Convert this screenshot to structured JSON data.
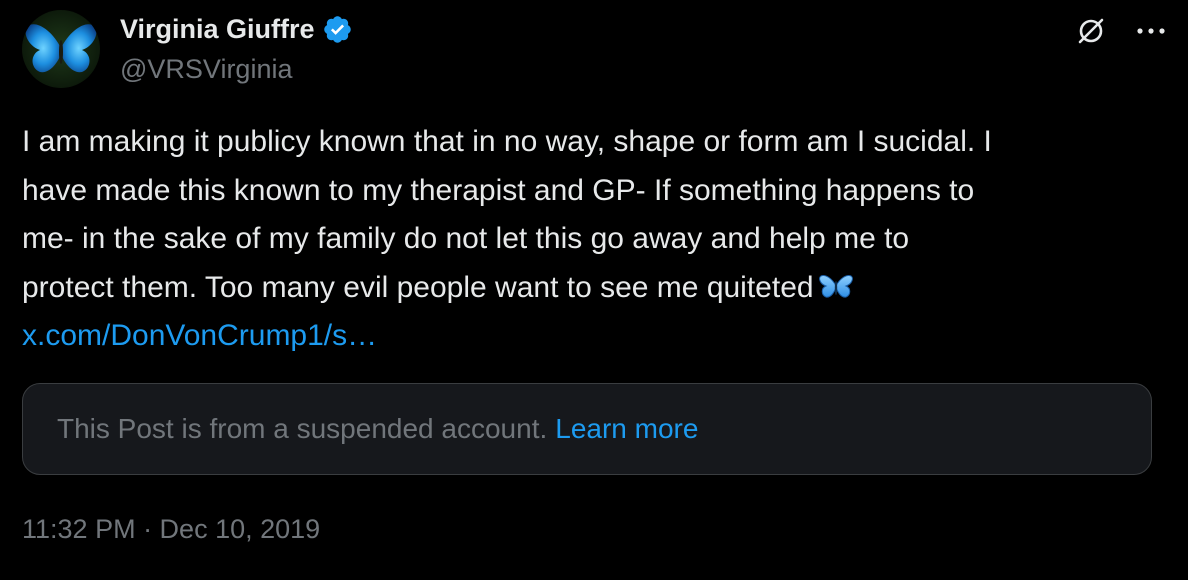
{
  "author": {
    "display_name": "Virginia Giuffre",
    "handle": "@VRSVirginia",
    "avatar_icon": "butterfly-avatar",
    "verified_icon": "verified-badge-icon",
    "verified_color": "#1d9bf0"
  },
  "toolbar": {
    "grok_icon": "slashed-circle-icon",
    "more_icon": "more-horizontal-icon"
  },
  "tweet": {
    "lines": [
      "I am making it publicy known that in no way, shape or form am I sucidal. I",
      "have made this known to my therapist and GP- If something happens to",
      "me- in the sake of my family do not let this go away and help me to",
      "protect them. Too many evil people want to see me quiteted"
    ],
    "emoji": "butterfly-emoji",
    "link_text": "x.com/DonVonCrump1/s…"
  },
  "quoted_post": {
    "notice_text": "This Post is from a suspended account.",
    "learn_more_label": "Learn more"
  },
  "timestamp": "11:32 PM · Dec 10, 2019",
  "colors": {
    "background": "#000000",
    "primary_text": "#e7e9ea",
    "secondary_text": "#71767b",
    "link": "#1d9bf0",
    "box_border": "#3a3d40",
    "box_background": "#16181c"
  }
}
